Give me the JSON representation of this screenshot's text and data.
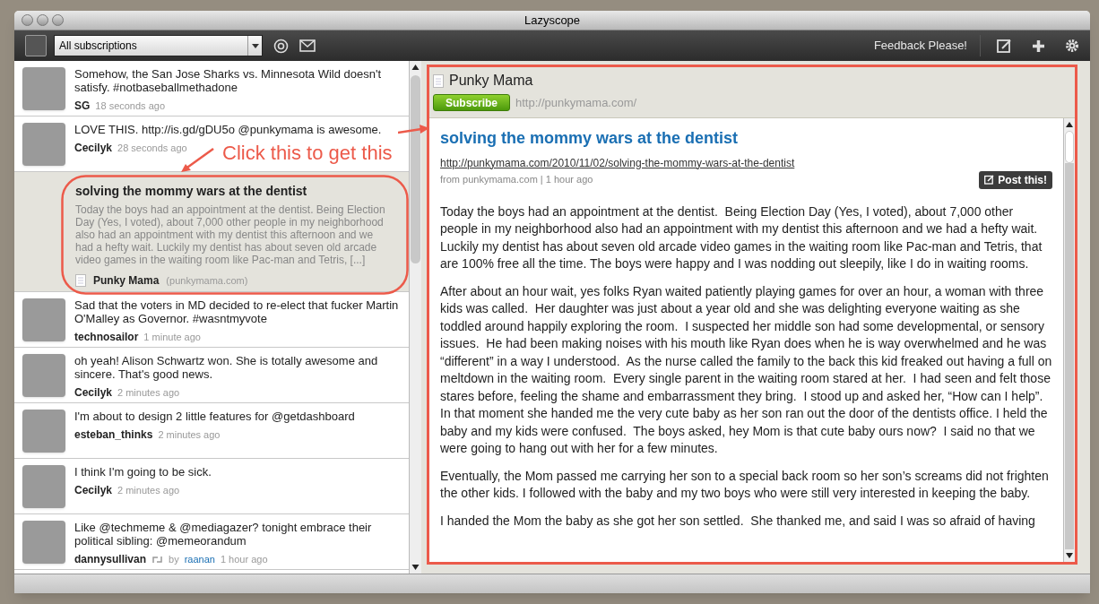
{
  "window": {
    "title": "Lazyscope"
  },
  "toolbar": {
    "subscription_select": "All subscriptions",
    "feedback": "Feedback Please!"
  },
  "feed": [
    {
      "kind": "tweet",
      "selected": false,
      "text": "Somehow, the San Jose Sharks vs. Minnesota Wild doesn't satisfy. #notbaseballmethadone",
      "user": "SG",
      "time": "18 seconds ago"
    },
    {
      "kind": "tweet",
      "selected": false,
      "text": "LOVE THIS. http://is.gd/gDU5o @punkymama is awesome.",
      "user": "Cecilyk",
      "time": "28 seconds ago"
    },
    {
      "kind": "article",
      "selected": true,
      "title": "solving the mommy wars at the dentist",
      "excerpt": "Today the boys had an appointment at the dentist. Being Election Day (Yes, I voted), about 7,000 other people in my neighborhood also had an appointment with my dentist this afternoon and we had a hefty wait. Luckily my dentist has about seven old arcade video games in the waiting room like Pac-man and Tetris, [...]",
      "source": "Punky Mama",
      "domain": "(punkymama.com)"
    },
    {
      "kind": "tweet",
      "selected": false,
      "text": "Sad that the voters in MD decided to re-elect that fucker Martin O'Malley as Governor. #wasntmyvote",
      "user": "technosailor",
      "time": "1 minute ago"
    },
    {
      "kind": "tweet",
      "selected": false,
      "text": "oh yeah! Alison Schwartz won. She is totally awesome and sincere. That's good news.",
      "user": "Cecilyk",
      "time": "2 minutes ago"
    },
    {
      "kind": "tweet",
      "selected": false,
      "text": "I'm about to design 2 little features for @getdashboard",
      "user": "esteban_thinks",
      "time": "2 minutes ago"
    },
    {
      "kind": "tweet",
      "selected": false,
      "text": "I think I'm going to be sick.",
      "user": "Cecilyk",
      "time": "2 minutes ago"
    },
    {
      "kind": "tweet",
      "selected": false,
      "text": "Like @techmeme & @mediagazer? tonight embrace their political sibling: @memeorandum",
      "user": "dannysullivan",
      "retweet_by_label": "by",
      "retweet_by": "raanan",
      "time": "1 hour ago"
    }
  ],
  "reader": {
    "source_title": "Punky Mama",
    "subscribe_button": "Subscribe",
    "url": "http://punkymama.com/",
    "article_title": "solving the mommy wars at the dentist",
    "article_url": "http://punkymama.com/2010/11/02/solving-the-mommy-wars-at-the-dentist",
    "meta": "from punkymama.com | 1 hour ago",
    "post_button": "Post this!",
    "paragraphs": [
      "Today the boys had an appointment at the dentist.  Being Election Day (Yes, I voted), about 7,000 other people in my neighborhood also had an appointment with my dentist this afternoon and we had a hefty wait. Luckily my dentist has about seven old arcade video games in the waiting room like Pac-man and Tetris, that are 100% free all the time. The boys were happy and I was nodding out sleepily, like I do in waiting rooms.",
      "After about an hour wait, yes folks Ryan waited patiently playing games for over an hour, a woman with three kids was called.  Her daughter was just about a year old and she was delighting everyone waiting as she toddled around happily exploring the room.  I suspected her middle son had some developmental, or sensory issues.  He had been making noises with his mouth like Ryan does when he is way overwhelmed and he was “different” in a way I understood.  As the nurse called the family to the back this kid freaked out having a full on meltdown in the waiting room.  Every single parent in the waiting room stared at her.  I had seen and felt those stares before, feeling the shame and embarrassment they bring.  I stood up and asked her, “How can I help”.  In that moment she handed me the very cute baby as her son ran out the door of the dentists office. I held the baby and my kids were confused.  The boys asked, hey Mom is that cute baby ours now?  I said no that we were going to hang out with her for a few minutes.",
      "Eventually, the Mom passed me carrying her son to a special back room so her son’s screams did not frighten the other kids. I followed with the baby and my two boys who were still very interested in keeping the baby.",
      "I handed the Mom the baby as she got her son settled.  She thanked me, and said I was so afraid of having"
    ]
  },
  "annotation": {
    "text": "Click this to get this"
  }
}
